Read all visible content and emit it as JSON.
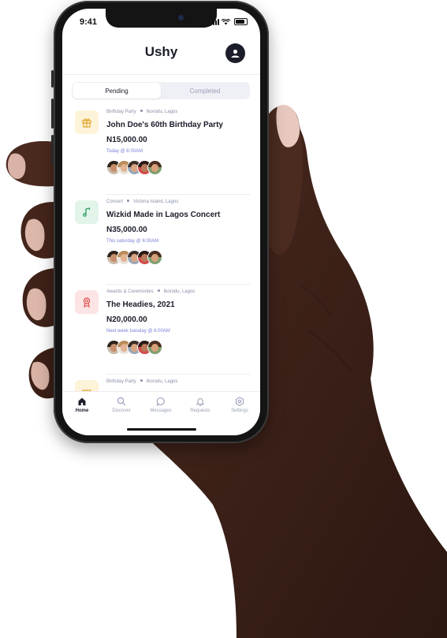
{
  "status": {
    "time": "9:41"
  },
  "app": {
    "title": "Ushy"
  },
  "tabs": [
    {
      "label": "Pending",
      "active": true
    },
    {
      "label": "Completed",
      "active": false
    }
  ],
  "events": [
    {
      "category": "Birthday Party",
      "location": "Ikorodu, Lagos",
      "title": "John Doe's 60th Birthday Party",
      "price": "N15,000.00",
      "when": "Today @ 6:00AM",
      "icon": "gift-icon",
      "icon_bg": "#fdf3d8",
      "icon_color": "#e2a72e"
    },
    {
      "category": "Concert",
      "location": "Victoria Island, Lagos",
      "title": "Wizkid Made in Lagos Concert",
      "price": "N35,000.00",
      "when": "This saturday @ 6:00AM",
      "icon": "music-note-icon",
      "icon_bg": "#e3f5ea",
      "icon_color": "#2f9e5f"
    },
    {
      "category": "Awards & Ceremonies",
      "location": "Ikorodu, Lagos",
      "title": "The Headies, 2021",
      "price": "N20,000.00",
      "when": "Next week tuesday @ 6:00AM",
      "icon": "award-icon",
      "icon_bg": "#fde4e4",
      "icon_color": "#e05555"
    },
    {
      "category": "Birthday Party",
      "location": "Ikorodu, Lagos",
      "icon": "gift-icon",
      "icon_bg": "#fdf3d8",
      "icon_color": "#e2a72e"
    }
  ],
  "nav": [
    {
      "label": "Home",
      "icon": "home-icon",
      "active": true
    },
    {
      "label": "Discover",
      "icon": "search-icon",
      "active": false
    },
    {
      "label": "Messages",
      "icon": "chat-bubble-icon",
      "active": false
    },
    {
      "label": "Requests",
      "icon": "bell-icon",
      "active": false
    },
    {
      "label": "Settings",
      "icon": "settings-icon",
      "active": false
    }
  ],
  "colors": {
    "accent": "#7b7fd6",
    "text": "#1b1d2a",
    "muted": "#9aa0b8"
  }
}
